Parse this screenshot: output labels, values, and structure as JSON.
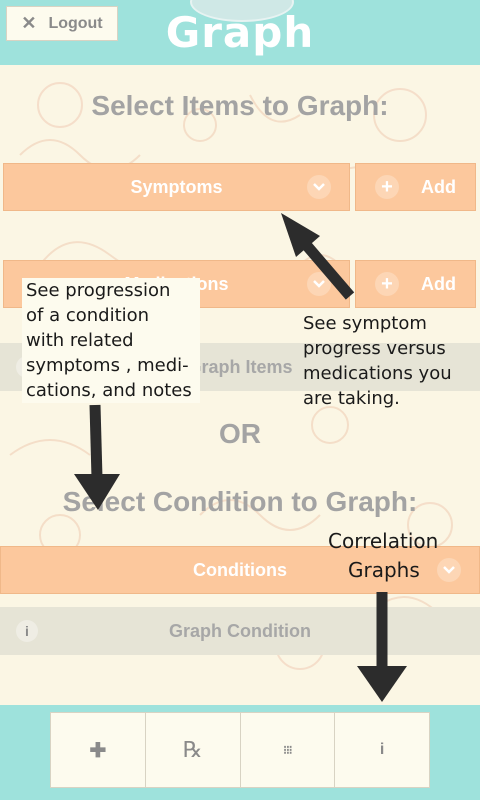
{
  "header": {
    "logout_label": "Logout",
    "app_title": "Graph"
  },
  "items_section": {
    "title": "Select Items to Graph:",
    "symptoms_dropdown": "Symptoms",
    "medications_dropdown": "Medications",
    "add_label": "Add",
    "graph_items_button": "Graph Items"
  },
  "or_label": "OR",
  "condition_section": {
    "title": "Select Condition to Graph:",
    "conditions_dropdown": "Conditions",
    "graph_condition_button": "Graph Condition"
  },
  "annotations": {
    "left_lines": [
      "See progression",
      "of a condition",
      "with related",
      "symptoms , medi-",
      "cations, and notes"
    ],
    "right_lines": [
      "See symptom",
      "progress versus",
      "medications you",
      "are taking."
    ],
    "correlation_lines": [
      "Correlation",
      "Graphs"
    ]
  },
  "tabbar": {
    "tabs": [
      {
        "icon": "plus-icon",
        "glyph": "✚"
      },
      {
        "icon": "rx-icon",
        "glyph": "℞"
      },
      {
        "icon": "grid-icon",
        "glyph": "⁝⁝⁝"
      },
      {
        "icon": "info-icon",
        "glyph": "i"
      }
    ]
  },
  "colors": {
    "header_bg": "#9ee2dc",
    "page_bg": "#fbf6e4",
    "dropdown_bg": "#fcc89d",
    "graybar_bg": "#e6e4d6",
    "heading_text": "#a3a3a3"
  }
}
